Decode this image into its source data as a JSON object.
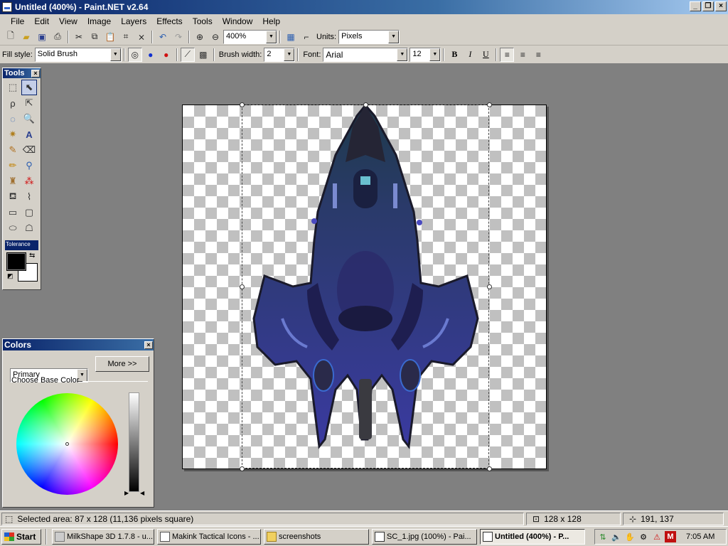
{
  "window": {
    "title": "Untitled (400%) - Paint.NET v2.64"
  },
  "menu": [
    "File",
    "Edit",
    "View",
    "Image",
    "Layers",
    "Effects",
    "Tools",
    "Window",
    "Help"
  ],
  "toolbar1": {
    "zoom": "400%",
    "units_label": "Units:",
    "units_value": "Pixels"
  },
  "toolbar2": {
    "fill_style_label": "Fill style:",
    "fill_style_value": "Solid Brush",
    "brush_width_label": "Brush width:",
    "brush_width_value": "2",
    "font_label": "Font:",
    "font_value": "Arial",
    "font_size": "12",
    "bold": "B",
    "italic": "I",
    "underline": "U"
  },
  "tools_window": {
    "title": "Tools",
    "tolerance_label": "Tolerance",
    "primary_color": "#000000",
    "secondary_color": "#ffffff"
  },
  "colors_window": {
    "title": "Colors",
    "mode": "Primary",
    "more_button": "More >>",
    "base_color_label": "Choose Base Color"
  },
  "statusbar": {
    "selection_info": "Selected area: 87 x 128 (11,136 pixels square)",
    "image_size": "128 x 128",
    "cursor_pos": "191, 137"
  },
  "taskbar": {
    "start": "Start",
    "tasks": [
      {
        "label": "MilkShape 3D 1.7.8 - u...",
        "active": false
      },
      {
        "label": "Makink Tactical Icons - ...",
        "active": false
      },
      {
        "label": "screenshots",
        "active": false
      },
      {
        "label": "SC_1.jpg (100%) - Pai...",
        "active": false
      },
      {
        "label": "Untitled (400%) - P...",
        "active": true
      }
    ],
    "clock": "7:05 AM"
  }
}
